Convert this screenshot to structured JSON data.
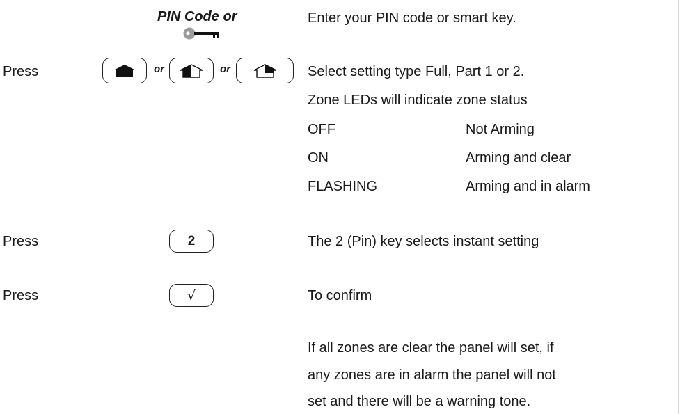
{
  "pin_step": {
    "heading": "PIN Code or",
    "icon": "smart-key-icon",
    "text": "Enter your PIN code or smart key."
  },
  "setting_step": {
    "action": "Press",
    "keys": [
      "full-set-key-icon",
      "part-set-1-key-icon",
      "part-set-2-key-icon"
    ],
    "or_label": "or",
    "lines": [
      "Select setting type Full, Part 1 or 2.",
      "Zone LEDs will indicate zone status"
    ],
    "led_states": [
      {
        "state": "OFF",
        "meaning": "Not Arming"
      },
      {
        "state": "ON",
        "meaning": "Arming and clear"
      },
      {
        "state": "FLASHING",
        "meaning": "Arming and in alarm"
      }
    ]
  },
  "instant_step": {
    "action": "Press",
    "key_label": "2",
    "text": "The 2 (Pin) key selects instant setting"
  },
  "confirm_step": {
    "action": "Press",
    "key_symbol": "√",
    "text": "To confirm"
  },
  "result_lines": [
    "If all zones are clear the panel will set, if",
    "any zones are in alarm the panel will not",
    "set and there will be a warning tone."
  ]
}
